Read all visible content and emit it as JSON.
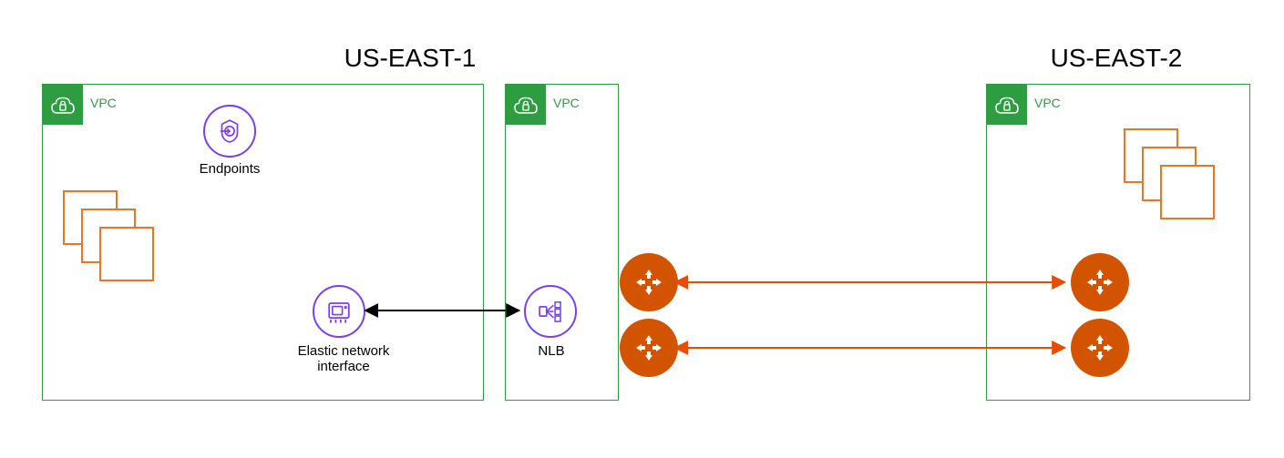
{
  "regions": {
    "left": {
      "title": "US-EAST-1"
    },
    "right": {
      "title": "US-EAST-2"
    }
  },
  "vpcs": {
    "vpc1": {
      "label": "VPC"
    },
    "vpc2": {
      "label": "VPC"
    },
    "vpc3": {
      "label": "VPC"
    }
  },
  "components": {
    "endpoints": {
      "label": "Endpoints"
    },
    "eni": {
      "label": "Elastic network\ninterface"
    },
    "nlb": {
      "label": "NLB"
    }
  },
  "colors": {
    "vpc_green": "#2e9c41",
    "purple": "#7b3ff2",
    "orange": "#e87722",
    "router": "#d35400",
    "arrow_orange": "#e84c00",
    "arrow_black": "#000000"
  }
}
